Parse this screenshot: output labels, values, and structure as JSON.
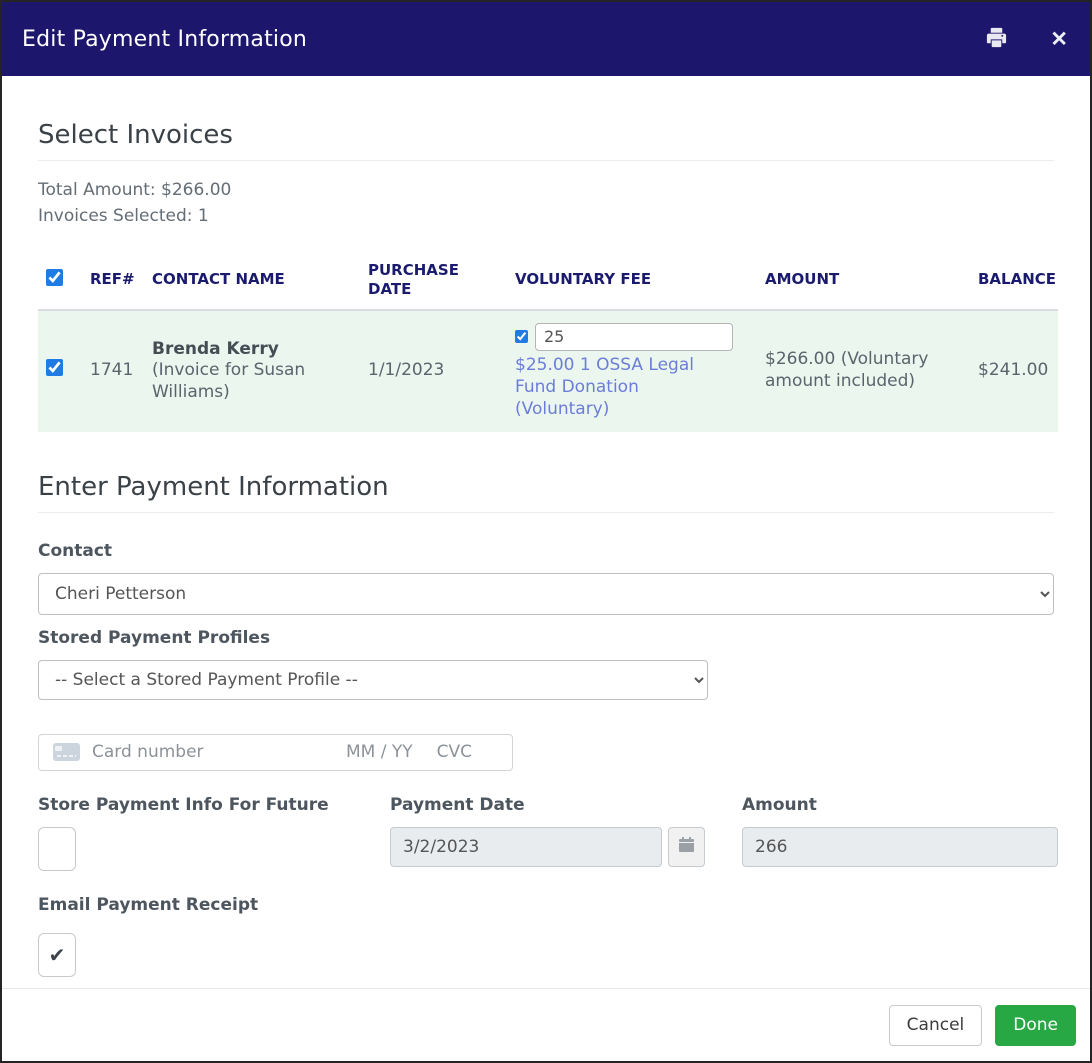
{
  "header": {
    "title": "Edit Payment Information"
  },
  "invoices": {
    "heading": "Select Invoices",
    "total_amount_line": "Total Amount: $266.00",
    "selected_line": "Invoices Selected: 1",
    "table": {
      "columns": [
        "REF#",
        "CONTACT NAME",
        "PURCHASE DATE",
        "VOLUNTARY FEE",
        "AMOUNT",
        "BALANCE"
      ],
      "select_all_checked": true,
      "row": {
        "selected": true,
        "ref": "1741",
        "contact_name": "Brenda Kerry",
        "contact_suffix": " (Invoice for Susan Williams)",
        "purchase_date": "1/1/2023",
        "voluntary_checked": true,
        "voluntary_value": "25",
        "voluntary_link": "$25.00 1 OSSA Legal Fund Donation (Voluntary)",
        "amount": "$266.00 (Voluntary amount included)",
        "balance": "$241.00"
      }
    }
  },
  "payment": {
    "heading": "Enter Payment Information",
    "contact_label": "Contact",
    "contact_value": "Cheri Petterson",
    "profiles_label": "Stored Payment Profiles",
    "profiles_value": "-- Select a Stored Payment Profile --",
    "card": {
      "number_placeholder": "Card number",
      "expiry_placeholder": "MM / YY",
      "cvc_placeholder": "CVC"
    },
    "store_label": "Store Payment Info For Future",
    "store_checked": false,
    "date_label": "Payment Date",
    "date_value": "3/2/2023",
    "amount_label": "Amount",
    "amount_value": "266",
    "email_label": "Email Payment Receipt",
    "email_checked": true
  },
  "footer": {
    "cancel_label": "Cancel",
    "done_label": "Done"
  },
  "colors": {
    "header_bg": "#1d166d",
    "navy_text": "#1a1a6e",
    "row_highlight": "#ebf6ef",
    "link": "#6b7dd8",
    "checkbox_accent": "#1f7ce4",
    "done_green": "#28a745"
  }
}
